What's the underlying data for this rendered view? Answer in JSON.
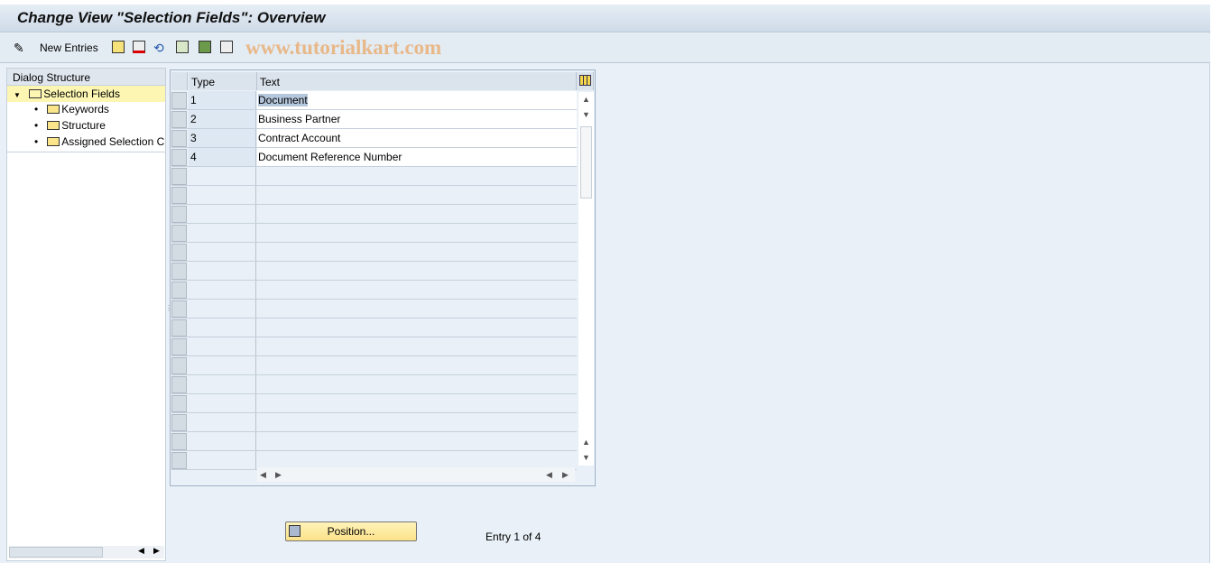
{
  "title": "Change View \"Selection Fields\": Overview",
  "toolbar": {
    "new_entries": "New Entries",
    "watermark": "www.tutorialkart.com"
  },
  "dialog": {
    "header": "Dialog Structure",
    "root": "Selection Fields",
    "children": [
      "Keywords",
      "Structure",
      "Assigned Selection C"
    ]
  },
  "table": {
    "columns": [
      "Type",
      "Text"
    ],
    "rows": [
      {
        "type": "1",
        "text": "Document"
      },
      {
        "type": "2",
        "text": "Business Partner"
      },
      {
        "type": "3",
        "text": "Contract Account"
      },
      {
        "type": "4",
        "text": "Document Reference Number"
      }
    ]
  },
  "footer": {
    "position": "Position...",
    "entry": "Entry 1 of 4"
  }
}
